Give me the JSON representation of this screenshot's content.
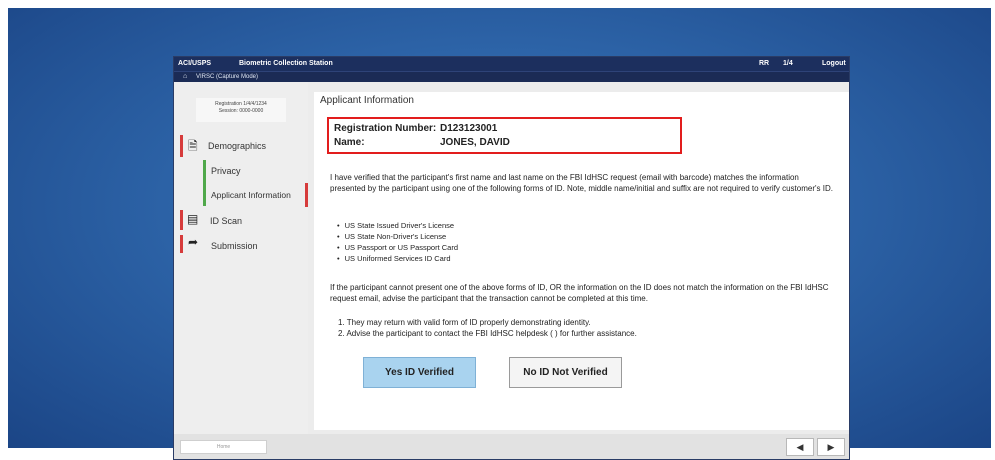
{
  "window": {
    "brand": "ACI/USPS",
    "title": "Biometric Collection Station",
    "top_right_1": "RR",
    "top_right_2": "1/4",
    "logout": "Logout",
    "home_icon": "home-icon",
    "mode_label": "VIRSC (Capture Mode)"
  },
  "sidebar": {
    "station_line1": "Registration 1/4/4/1234",
    "station_line2": "Session: 0000-0000",
    "items": [
      {
        "label": "Demographics",
        "icon": "document-icon"
      },
      {
        "label": "Privacy"
      },
      {
        "label": "Applicant Information"
      },
      {
        "label": "ID Scan",
        "icon": "scanner-icon"
      },
      {
        "label": "Submission",
        "icon": "submit-icon"
      }
    ]
  },
  "content": {
    "title": "Applicant Information",
    "reg_label": "Registration Number:",
    "reg_value": "D123123001",
    "name_label": "Name:",
    "name_value": "JONES, DAVID",
    "paragraph1": "I have verified that the participant's first name and last name on the FBI IdHSC request (email with barcode) matches the information presented by the participant using one of the following forms of ID. Note, middle name/initial and suffix are not required to verify customer's ID.",
    "id_list": [
      "US State Issued Driver's License",
      "US State Non-Driver's License",
      "US Passport or US Passport Card",
      "US Uniformed Services ID Card"
    ],
    "paragraph2": "If the participant cannot present one of the above forms of ID, OR the information on the ID does not match the information on the FBI IdHSC request email, advise the participant that the transaction cannot be completed at this time.",
    "steps": [
      "1.  They may return with valid form of ID properly demonstrating identity.",
      "2.  Advise the participant to contact the FBI IdHSC helpdesk (  ) for further assistance."
    ],
    "yes_button": "Yes ID Verified",
    "no_button": "No ID Not Verified"
  },
  "footer": {
    "field_text": "Home",
    "prev_label": "◀",
    "next_label": "▶"
  },
  "colors": {
    "titlebar": "#1c2f5e",
    "highlight_box": "#e21d1d",
    "yes_button": "#a9d3ef",
    "sidebar_marker_red": "#d63b3b",
    "sidebar_marker_green": "#4fa84a"
  }
}
